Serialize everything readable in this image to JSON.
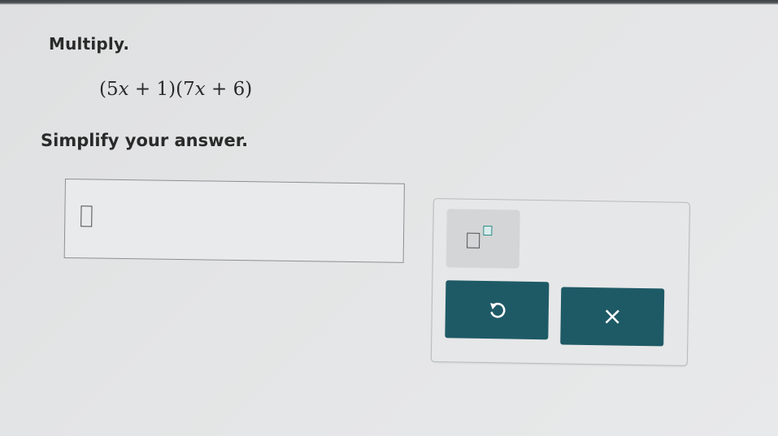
{
  "problem": {
    "instruction": "Multiply.",
    "expression": {
      "open1": "(",
      "coef1": "5",
      "var1": "x",
      "plus1": " + ",
      "const1": "1",
      "close1": ")",
      "open2": "(",
      "coef2": "7",
      "var2": "x",
      "plus2": " + ",
      "const2": "6",
      "close2": ")"
    },
    "prompt": "Simplify your answer."
  },
  "answer": {
    "value": ""
  },
  "palette": {
    "buttons": [
      {
        "name": "exponent-button",
        "icon": "exponent-template-icon"
      },
      {
        "name": "undo-button",
        "icon": "undo-icon"
      },
      {
        "name": "clear-button",
        "icon": "close-icon",
        "label": "×"
      }
    ]
  },
  "colors": {
    "button_dark": "#1e5a66",
    "exponent_accent": "#2c8a86",
    "background": "#e4e5e6"
  }
}
